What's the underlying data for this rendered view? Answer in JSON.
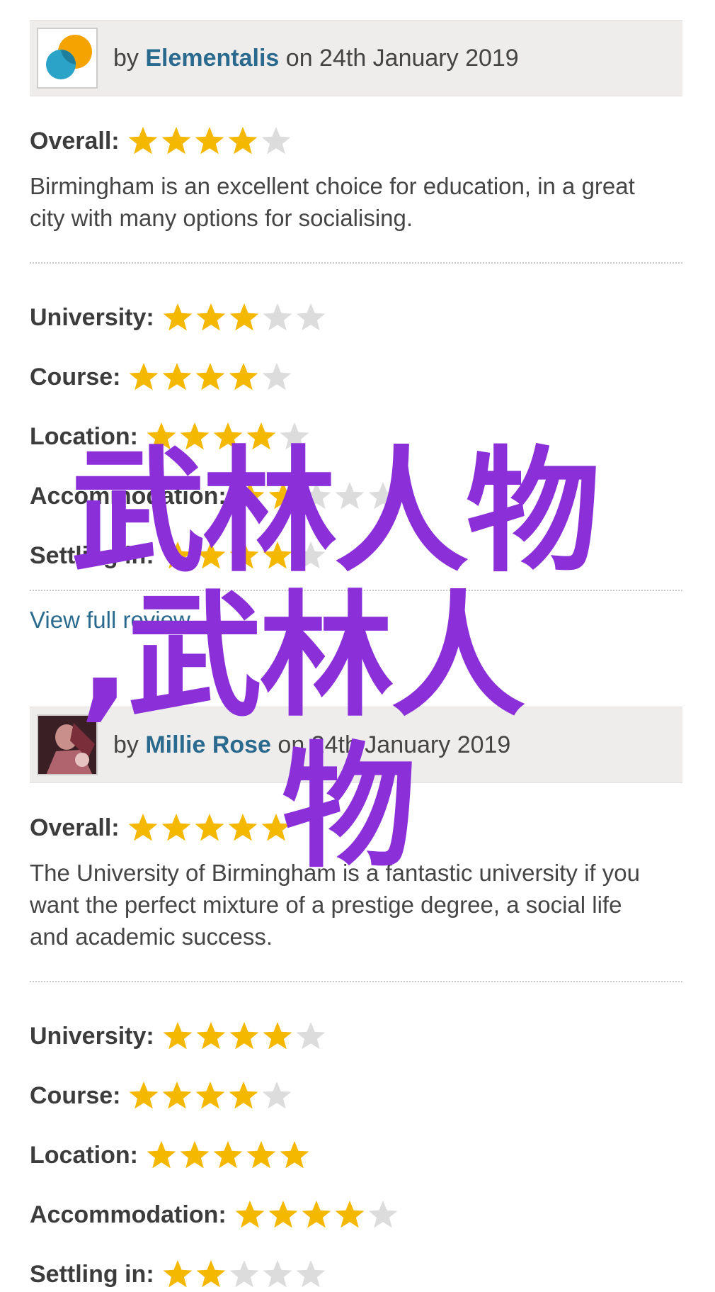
{
  "reviews": [
    {
      "byline_prefix": "by ",
      "author": "Elementalis",
      "date_text": " on 24th January 2019",
      "overall_label": "Overall:",
      "overall_rating": 4,
      "text": "Birmingham is an excellent choice for education, in a great city with many options for socialising.",
      "criteria": [
        {
          "label": "University:",
          "rating": 3
        },
        {
          "label": "Course:",
          "rating": 4
        },
        {
          "label": "Location:",
          "rating": 4
        },
        {
          "label": "Accommodation:",
          "rating": 2
        },
        {
          "label": "Settling in:",
          "rating": 4
        }
      ],
      "view_link": "View full review"
    },
    {
      "byline_prefix": "by ",
      "author": "Millie Rose",
      "date_text": " on 24th January 2019",
      "overall_label": "Overall:",
      "overall_rating": 5,
      "text": "The University of Birmingham is a fantastic university if you want the perfect mixture of a prestige degree, a social life and academic success.",
      "criteria": [
        {
          "label": "University:",
          "rating": 4
        },
        {
          "label": "Course:",
          "rating": 4
        },
        {
          "label": "Location:",
          "rating": 5
        },
        {
          "label": "Accommodation:",
          "rating": 4
        },
        {
          "label": "Settling in:",
          "rating": 2
        }
      ]
    }
  ],
  "max_rating": 5,
  "overlay": {
    "line1": "武林人物",
    "line2": ",武林人",
    "line3": "物"
  },
  "colors": {
    "star_filled": "#f5b800",
    "star_empty": "#dcdcdc",
    "author_link": "#2a6a8e",
    "overlay": "#8b2fd9"
  }
}
